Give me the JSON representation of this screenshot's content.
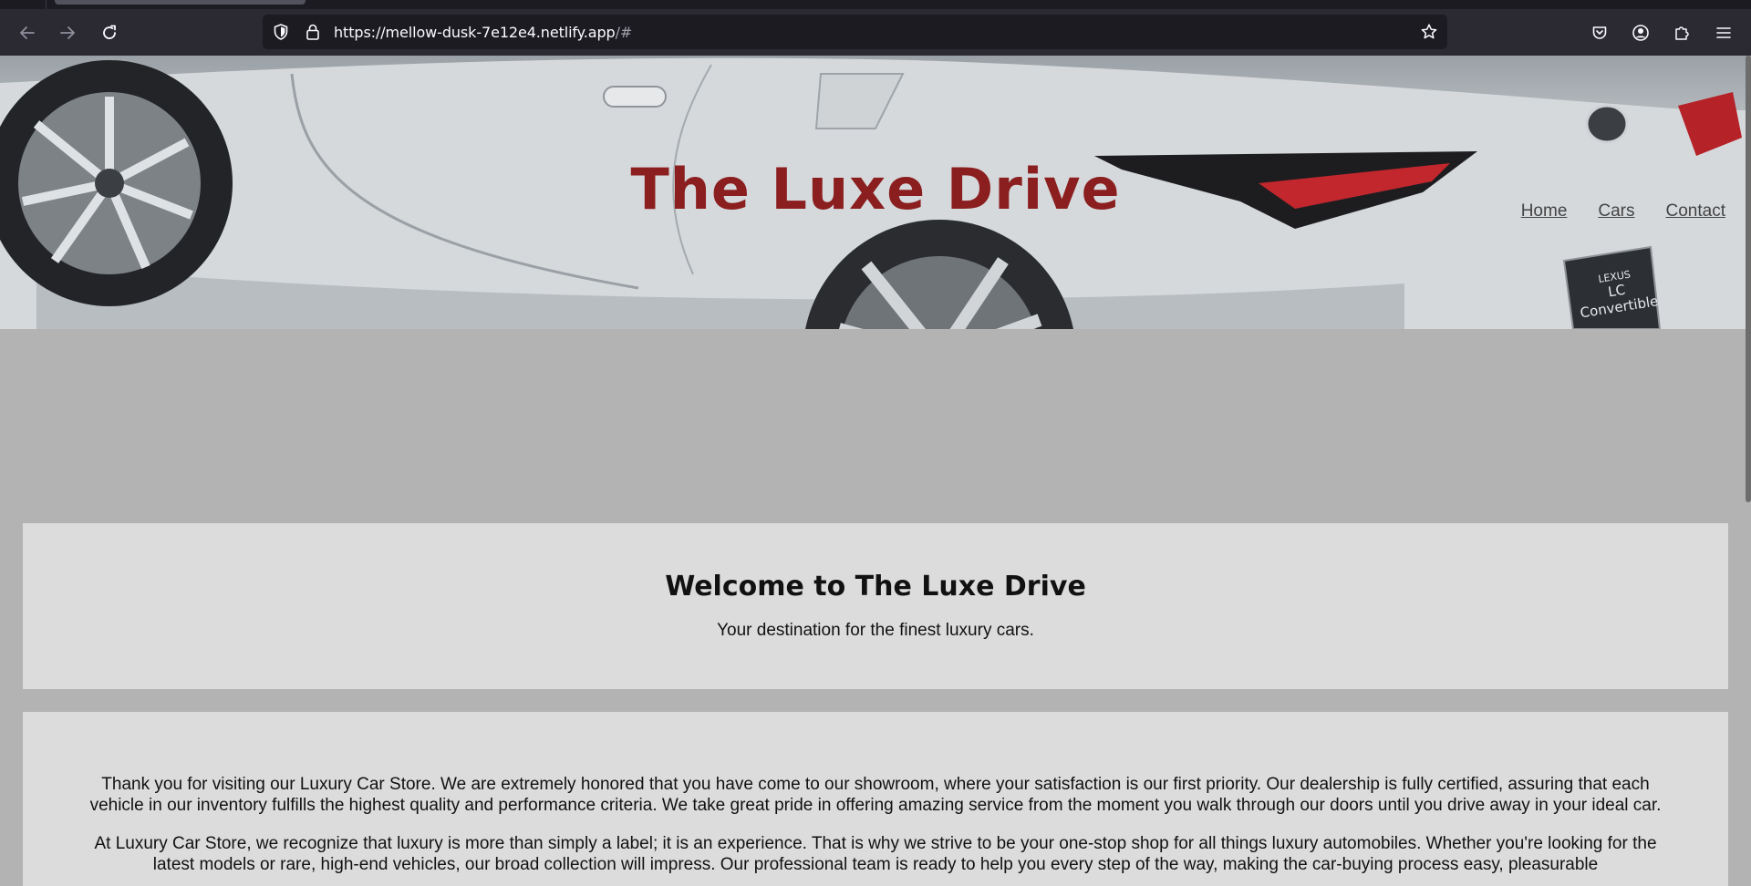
{
  "browser": {
    "url_host": "https://mellow-dusk-7e12e4.netlify.app",
    "url_path": "/#"
  },
  "site": {
    "title": "The Luxe Drive",
    "nav": [
      "Home",
      "Cars",
      "Contact"
    ],
    "badge_line1": "LEXUS",
    "badge_line2": "LC Convertible"
  },
  "welcome": {
    "heading": "Welcome to The Luxe Drive",
    "subtitle": "Your destination for the finest luxury cars."
  },
  "about": {
    "paragraphs": [
      "Thank you for visiting our Luxury Car Store. We are extremely honored that you have come to our showroom, where your satisfaction is our first priority. Our dealership is fully certified, assuring that each vehicle in our inventory fulfills the highest quality and performance criteria. We take great pride in offering amazing service from the moment you walk through our doors until you drive away in your ideal car.",
      "At Luxury Car Store, we recognize that luxury is more than simply a label; it is an experience. That is why we strive to be your one-stop shop for all things luxury automobiles. Whether you're looking for the latest models or rare, high-end vehicles, our broad collection will impress. Our professional team is ready to help you every step of the way, making the car-buying process easy, pleasurable"
    ]
  },
  "colors": {
    "title": "#8b1e1e",
    "page_bg": "#b3b3b3",
    "card_bg": "#dcdcdc"
  },
  "icons": [
    "back-icon",
    "forward-icon",
    "reload-icon",
    "shield-icon",
    "lock-icon",
    "bookmark-star-icon",
    "pocket-icon",
    "account-icon",
    "extensions-icon",
    "menu-icon"
  ]
}
